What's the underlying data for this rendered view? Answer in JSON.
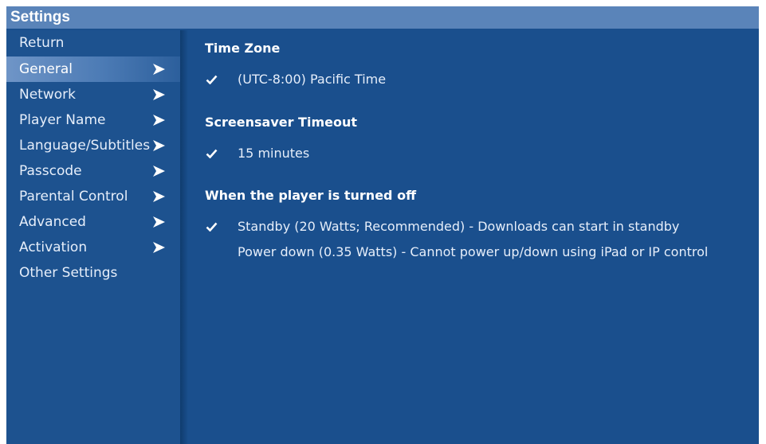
{
  "window": {
    "title": "Settings"
  },
  "sidebar": {
    "items": [
      {
        "label": "Return",
        "has_arrow": false,
        "selected": false
      },
      {
        "label": "General",
        "has_arrow": true,
        "selected": true
      },
      {
        "label": "Network",
        "has_arrow": true,
        "selected": false
      },
      {
        "label": "Player Name",
        "has_arrow": true,
        "selected": false
      },
      {
        "label": "Language/Subtitles",
        "has_arrow": true,
        "selected": false
      },
      {
        "label": "Passcode",
        "has_arrow": true,
        "selected": false
      },
      {
        "label": "Parental Control",
        "has_arrow": true,
        "selected": false
      },
      {
        "label": "Advanced",
        "has_arrow": true,
        "selected": false
      },
      {
        "label": "Activation",
        "has_arrow": true,
        "selected": false
      },
      {
        "label": "Other Settings",
        "has_arrow": false,
        "selected": false
      }
    ]
  },
  "main": {
    "sections": [
      {
        "title": "Time Zone",
        "options": [
          {
            "label": "(UTC-8:00) Pacific Time",
            "checked": true
          }
        ]
      },
      {
        "title": "Screensaver Timeout",
        "options": [
          {
            "label": "15 minutes",
            "checked": true
          }
        ]
      },
      {
        "title": "When the player is turned off",
        "options": [
          {
            "label": "Standby (20 Watts; Recommended) - Downloads can start in standby",
            "checked": true
          },
          {
            "label": "Power down (0.35 Watts) - Cannot power up/down using iPad or IP control",
            "checked": false
          }
        ]
      }
    ]
  },
  "icons": {
    "menu_arrow": "chevron-right-icon",
    "check": "checkmark-icon"
  },
  "colors": {
    "titlebar": "#5a84b9",
    "background": "#1a4f8d",
    "selection": "#4c7bb5",
    "text": "#e6eefa"
  }
}
